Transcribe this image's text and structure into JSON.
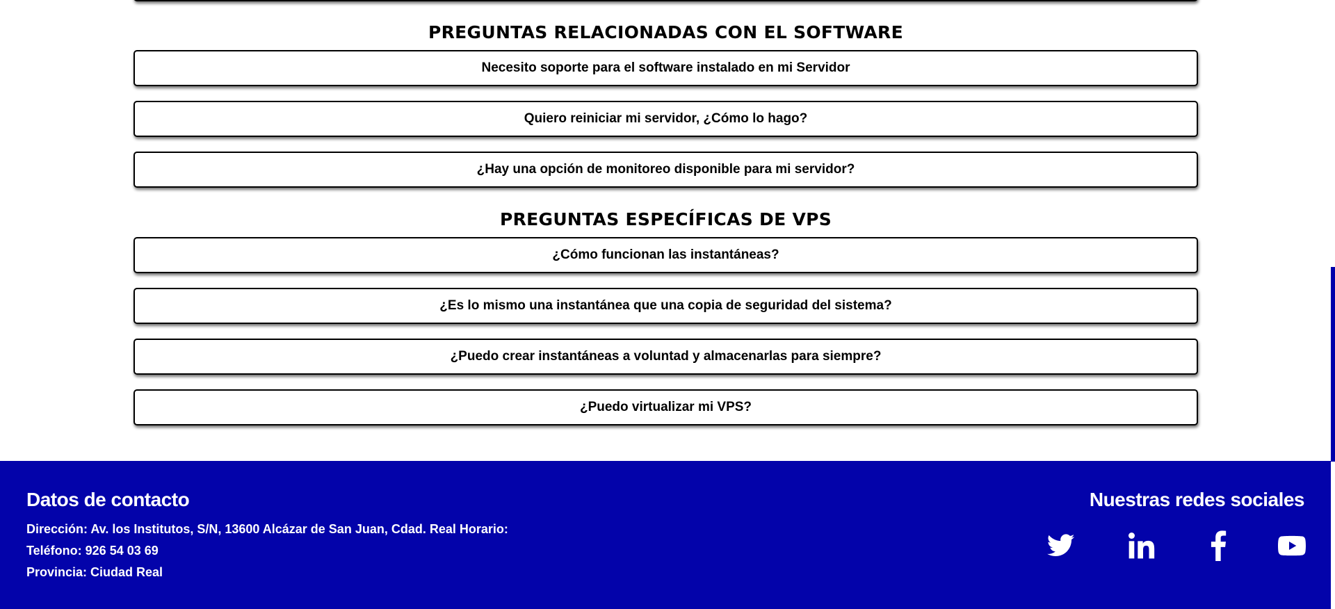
{
  "faq": {
    "sections": [
      {
        "title": "PREGUNTAS RELACIONADAS CON EL SOFTWARE",
        "questions": [
          "Necesito soporte para el software instalado en mi Servidor",
          "Quiero reiniciar mi servidor, ¿Cómo lo hago?",
          "¿Hay una opción de monitoreo disponible para mi servidor?"
        ]
      },
      {
        "title": "PREGUNTAS ESPECÍFICAS DE VPS",
        "questions": [
          "¿Cómo funcionan las instantáneas?",
          "¿Es lo mismo una instantánea que una copia de seguridad del sistema?",
          "¿Puedo crear instantáneas a voluntad y almacenarlas para siempre?",
          "¿Puedo virtualizar mi VPS?"
        ]
      }
    ]
  },
  "footer": {
    "contact": {
      "title": "Datos de contacto",
      "address": "Dirección: Av. los Institutos, S/N, 13600 Alcázar de San Juan, Cdad. Real Horario:",
      "phone": "Teléfono: 926 54 03 69",
      "province": "Provincia: Ciudad Real"
    },
    "social": {
      "title": "Nuestras redes sociales",
      "icons": [
        "twitter-icon",
        "linkedin-icon",
        "facebook-icon",
        "youtube-icon"
      ]
    },
    "background_color": "#0303aa"
  }
}
